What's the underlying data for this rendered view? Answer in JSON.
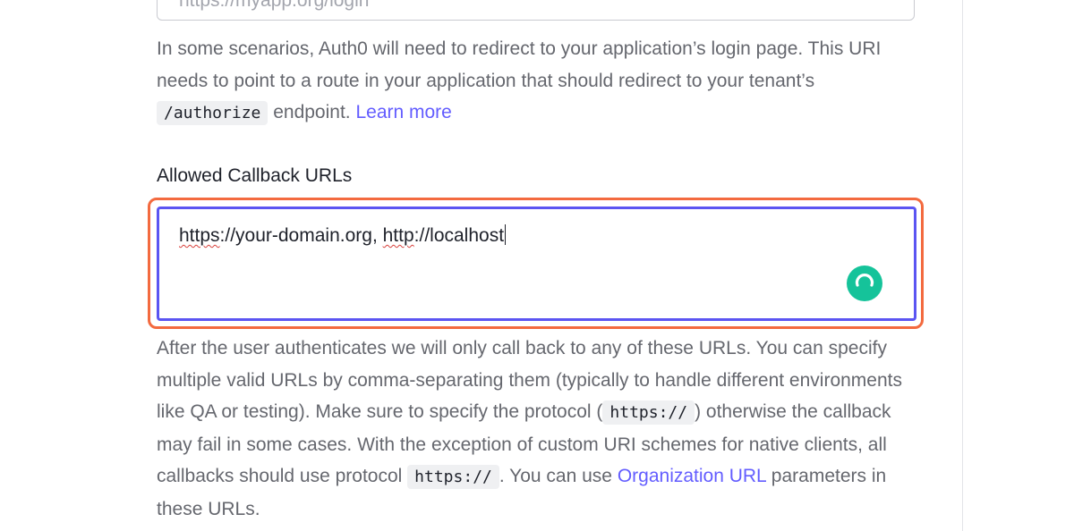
{
  "login_uri": {
    "input_value": "https://myapp.org/login",
    "help": {
      "line1": "In some scenarios, Auth0 will need to redirect to your application’s login page. This URI needs to point to a route in your application that should redirect to your tenant’s ",
      "code": "/authorize",
      "after_code": " endpoint. ",
      "link": "Learn more"
    }
  },
  "callback": {
    "label": "Allowed Callback URLs",
    "value_part1": "https",
    "value_part2": "://your-domain.org, ",
    "value_part3": "http",
    "value_part4": "://localhost",
    "help": {
      "text1": "After the user authenticates we will only call back to any of these URLs. You can specify multiple valid URLs by comma-separating them (typically to handle different environments like QA or testing). Make sure to specify the protocol (",
      "code1": "https://",
      "text2": ") otherwise the callback may fail in some cases. With the exception of custom URI schemes for native clients, all callbacks should use protocol ",
      "code2": "https://",
      "text3": ". You can use ",
      "link": "Organization URL",
      "text4": " parameters in these URLs."
    }
  },
  "colors": {
    "accent": "#635dff",
    "focus_border": "#5b55f2",
    "focus_ring": "#f36a3f",
    "grammarly": "#15c39a"
  },
  "icons": {
    "grammarly": "grammarly-icon"
  }
}
